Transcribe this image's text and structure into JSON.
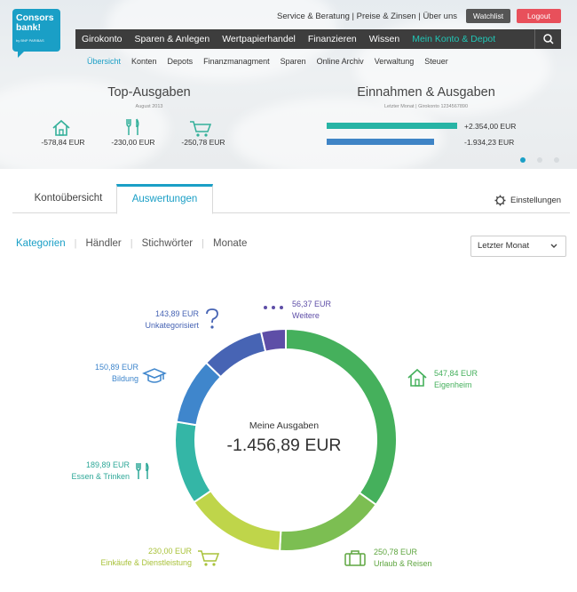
{
  "brand": {
    "logo_text_1": "Consors",
    "logo_text_2": "bank!",
    "logo_sub": "by BNP PARIBAS",
    "color": "#1a9fc6"
  },
  "header": {
    "service_links": "Service & Beratung | Preise & Zinsen | Über uns",
    "watchlist": "Watchlist",
    "logout": "Logout"
  },
  "mainnav": [
    "Girokonto",
    "Sparen & Anlegen",
    "Wertpapierhandel",
    "Finanzieren",
    "Wissen",
    "Mein Konto & Depot"
  ],
  "subnav": [
    "Übersicht",
    "Konten",
    "Depots",
    "Finanzmanagment",
    "Sparen",
    "Online Archiv",
    "Verwaltung",
    "Steuer"
  ],
  "top_ausgaben": {
    "title": "Top-Ausgaben",
    "subtitle": "August 2013",
    "items": [
      {
        "icon": "house-icon",
        "value": "-578,84 EUR"
      },
      {
        "icon": "cutlery-icon",
        "value": "-230,00 EUR"
      },
      {
        "icon": "cart-icon",
        "value": "-250,78 EUR"
      }
    ]
  },
  "einnahmen": {
    "title": "Einnahmen & Ausgaben",
    "subtitle": "Letzter Monat  |  Girokonto 1234567890",
    "income": {
      "label": "+2.354,00 EUR",
      "value": 2354.0,
      "color": "#27b4a5"
    },
    "expense": {
      "label": "-1.934,23 EUR",
      "value": 1934.23,
      "color": "#3f84c6"
    }
  },
  "carousel": {
    "count": 3,
    "active": 0
  },
  "tabs": {
    "items": [
      "Kontoübersicht",
      "Auswertungen"
    ],
    "active": 1,
    "settings": "Einstellungen"
  },
  "filters": {
    "items": [
      "Kategorien",
      "Händler",
      "Stichwörter",
      "Monate"
    ],
    "active": 0,
    "period": "Letzter Monat"
  },
  "donut": {
    "center_label": "Meine Ausgaben",
    "center_value": "-1.456,89 EUR",
    "categories": [
      {
        "name": "Eigenheim",
        "amount_text": "547,84 EUR",
        "amount": 547.84,
        "color": "#45b05c",
        "icon": "house-icon"
      },
      {
        "name": "Urlaub & Reisen",
        "amount_text": "250,78 EUR",
        "amount": 250.78,
        "color": "#7cbe52",
        "icon": "suitcase-icon"
      },
      {
        "name": "Einkäufe & Dienstleistung",
        "amount_text": "230,00 EUR",
        "amount": 230.0,
        "color": "#bfd54a",
        "icon": "cart-icon"
      },
      {
        "name": "Essen & Trinken",
        "amount_text": "189,89 EUR",
        "amount": 189.89,
        "color": "#34b6a6",
        "icon": "cutlery-icon"
      },
      {
        "name": "Bildung",
        "amount_text": "150,89 EUR",
        "amount": 150.89,
        "color": "#3f86cc",
        "icon": "graduation-cap-icon"
      },
      {
        "name": "Unkategorisiert",
        "amount_text": "143,89 EUR",
        "amount": 143.89,
        "color": "#4764b4",
        "icon": "question-icon"
      },
      {
        "name": "Weitere",
        "amount_text": "56,37 EUR",
        "amount": 56.37,
        "color": "#5e4ea7",
        "icon": "more-dots-icon"
      }
    ]
  }
}
